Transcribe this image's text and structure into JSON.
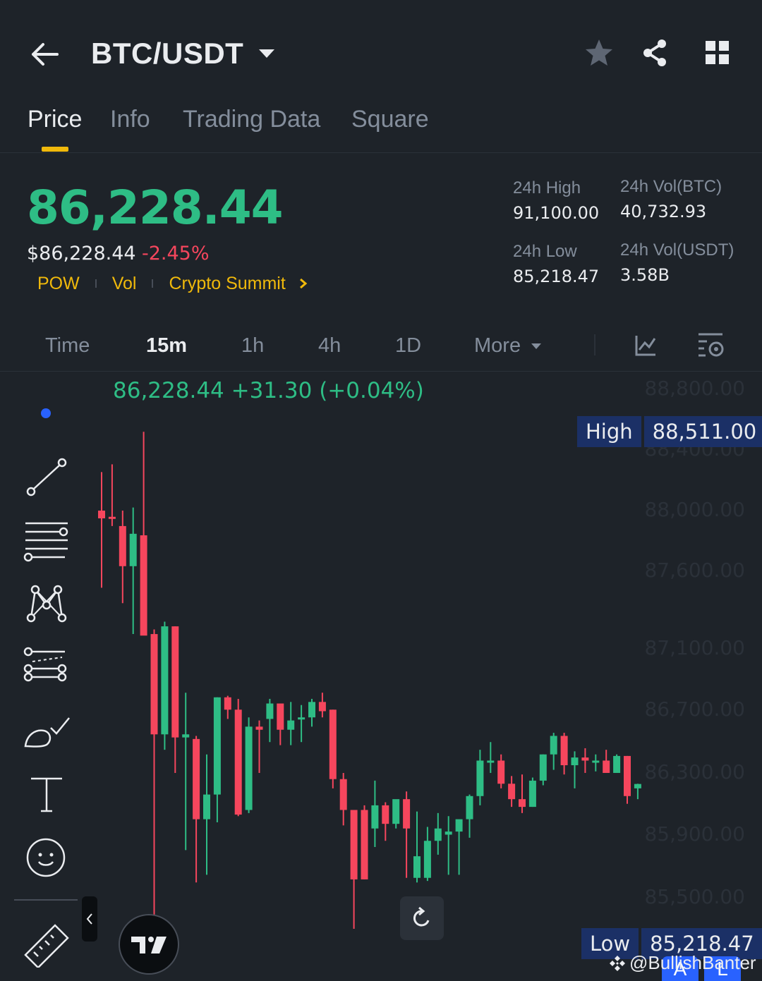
{
  "header": {
    "title": "BTC/USDT",
    "icons": [
      "back-arrow-icon",
      "caret-down-icon",
      "star-icon",
      "share-icon",
      "grid-icon"
    ]
  },
  "tabs": [
    {
      "label": "Price",
      "active": true
    },
    {
      "label": "Info",
      "active": false
    },
    {
      "label": "Trading Data",
      "active": false
    },
    {
      "label": "Square",
      "active": false
    }
  ],
  "ticker": {
    "last_price": "86,228.44",
    "usd_price": "$86,228.44",
    "change_pct": "-2.45%",
    "tags": [
      "POW",
      "Vol",
      "Crypto Summit"
    ],
    "high_24h_label": "24h High",
    "high_24h": "91,100.00",
    "low_24h_label": "24h Low",
    "low_24h": "85,218.47",
    "vol_btc_label": "24h Vol(BTC)",
    "vol_btc": "40,732.93",
    "vol_usdt_label": "24h Vol(USDT)",
    "vol_usdt": "3.58B"
  },
  "intervals": {
    "items": [
      "Time",
      "15m",
      "1h",
      "4h",
      "1D"
    ],
    "active": "15m",
    "more_label": "More"
  },
  "chart": {
    "legend": "86,228.44  +31.30 (+0.04%)",
    "high_label": "High",
    "high_value": "88,511.00",
    "low_label": "Low",
    "low_value": "85,218.47",
    "price_axis": [
      "88,800.00",
      "88,400.00",
      "88,000.00",
      "87,600.00",
      "87,100.00",
      "86,700.00",
      "86,300.00",
      "85,900.00",
      "85,500.00"
    ],
    "colors": {
      "up": "#2ebd85",
      "down": "#f6465d",
      "background": "#1e2329"
    }
  },
  "chart_data": {
    "type": "candlestick",
    "ylim": [
      85218.47,
      88800
    ],
    "candles": [
      {
        "o": 88000,
        "h": 88250,
        "l": 87500,
        "c": 87950
      },
      {
        "o": 87960,
        "h": 88300,
        "l": 87900,
        "c": 87950
      },
      {
        "o": 87900,
        "h": 88000,
        "l": 87400,
        "c": 87640
      },
      {
        "o": 87640,
        "h": 88020,
        "l": 87200,
        "c": 87850
      },
      {
        "o": 87840,
        "h": 88511,
        "l": 87380,
        "c": 87190
      },
      {
        "o": 87200,
        "h": 87230,
        "l": 85350,
        "c": 86550
      },
      {
        "o": 86550,
        "h": 87280,
        "l": 86450,
        "c": 87250
      },
      {
        "o": 87250,
        "h": 87250,
        "l": 86300,
        "c": 86530
      },
      {
        "o": 86530,
        "h": 86820,
        "l": 85800,
        "c": 86550
      },
      {
        "o": 86520,
        "h": 86540,
        "l": 85590,
        "c": 86000
      },
      {
        "o": 86000,
        "h": 86420,
        "l": 85640,
        "c": 86160
      },
      {
        "o": 86160,
        "h": 86790,
        "l": 85980,
        "c": 86790
      },
      {
        "o": 86790,
        "h": 86800,
        "l": 86650,
        "c": 86710
      },
      {
        "o": 86710,
        "h": 86780,
        "l": 86020,
        "c": 86030
      },
      {
        "o": 86060,
        "h": 86660,
        "l": 86040,
        "c": 86600
      },
      {
        "o": 86600,
        "h": 86640,
        "l": 86300,
        "c": 86580
      },
      {
        "o": 86650,
        "h": 86780,
        "l": 86500,
        "c": 86750
      },
      {
        "o": 86750,
        "h": 86750,
        "l": 86480,
        "c": 86580
      },
      {
        "o": 86580,
        "h": 86760,
        "l": 86480,
        "c": 86640
      },
      {
        "o": 86660,
        "h": 86740,
        "l": 86500,
        "c": 86660
      },
      {
        "o": 86660,
        "h": 86780,
        "l": 86600,
        "c": 86760
      },
      {
        "o": 86760,
        "h": 86820,
        "l": 86660,
        "c": 86700
      },
      {
        "o": 86710,
        "h": 86710,
        "l": 86200,
        "c": 86260
      },
      {
        "o": 86260,
        "h": 86300,
        "l": 85960,
        "c": 86060
      },
      {
        "o": 86060,
        "h": 86060,
        "l": 85290,
        "c": 85610
      },
      {
        "o": 86060,
        "h": 86090,
        "l": 85610,
        "c": 85610
      },
      {
        "o": 85940,
        "h": 86250,
        "l": 85820,
        "c": 86090
      },
      {
        "o": 86090,
        "h": 86110,
        "l": 85860,
        "c": 85970
      },
      {
        "o": 85970,
        "h": 86110,
        "l": 85940,
        "c": 86130
      },
      {
        "o": 86130,
        "h": 86180,
        "l": 85620,
        "c": 85940
      },
      {
        "o": 85620,
        "h": 86050,
        "l": 85590,
        "c": 85760
      },
      {
        "o": 85620,
        "h": 85950,
        "l": 85600,
        "c": 85860
      },
      {
        "o": 85860,
        "h": 86040,
        "l": 85770,
        "c": 85940
      },
      {
        "o": 85900,
        "h": 86020,
        "l": 85640,
        "c": 85920
      },
      {
        "o": 85920,
        "h": 85980,
        "l": 85640,
        "c": 86000
      },
      {
        "o": 86000,
        "h": 86160,
        "l": 85880,
        "c": 86150
      },
      {
        "o": 86150,
        "h": 86450,
        "l": 86090,
        "c": 86380
      },
      {
        "o": 86380,
        "h": 86500,
        "l": 86300,
        "c": 86380
      },
      {
        "o": 86380,
        "h": 86420,
        "l": 86200,
        "c": 86230
      },
      {
        "o": 86230,
        "h": 86280,
        "l": 86080,
        "c": 86130
      },
      {
        "o": 86130,
        "h": 86290,
        "l": 86040,
        "c": 86080
      },
      {
        "o": 86080,
        "h": 86270,
        "l": 86080,
        "c": 86250
      },
      {
        "o": 86250,
        "h": 86420,
        "l": 86220,
        "c": 86420
      },
      {
        "o": 86420,
        "h": 86560,
        "l": 86320,
        "c": 86540
      },
      {
        "o": 86540,
        "h": 86560,
        "l": 86290,
        "c": 86350
      },
      {
        "o": 86350,
        "h": 86440,
        "l": 86200,
        "c": 86400
      },
      {
        "o": 86400,
        "h": 86460,
        "l": 86300,
        "c": 86380
      },
      {
        "o": 86380,
        "h": 86420,
        "l": 86310,
        "c": 86380
      },
      {
        "o": 86380,
        "h": 86450,
        "l": 86310,
        "c": 86300
      },
      {
        "o": 86300,
        "h": 86420,
        "l": 86310,
        "c": 86410
      },
      {
        "o": 86410,
        "h": 86410,
        "l": 86100,
        "c": 86150
      },
      {
        "o": 86200,
        "h": 86230,
        "l": 86130,
        "c": 86228.44
      }
    ]
  },
  "toolbar": {
    "tools": [
      "trend-line-icon",
      "horizontal-lines-icon",
      "pattern-icon",
      "fib-icon",
      "brush-icon",
      "text-icon",
      "emoji-icon",
      "ruler-icon"
    ]
  },
  "watermark": {
    "text": "@BullishBanter",
    "corner_a": "A",
    "corner_l": "L"
  }
}
